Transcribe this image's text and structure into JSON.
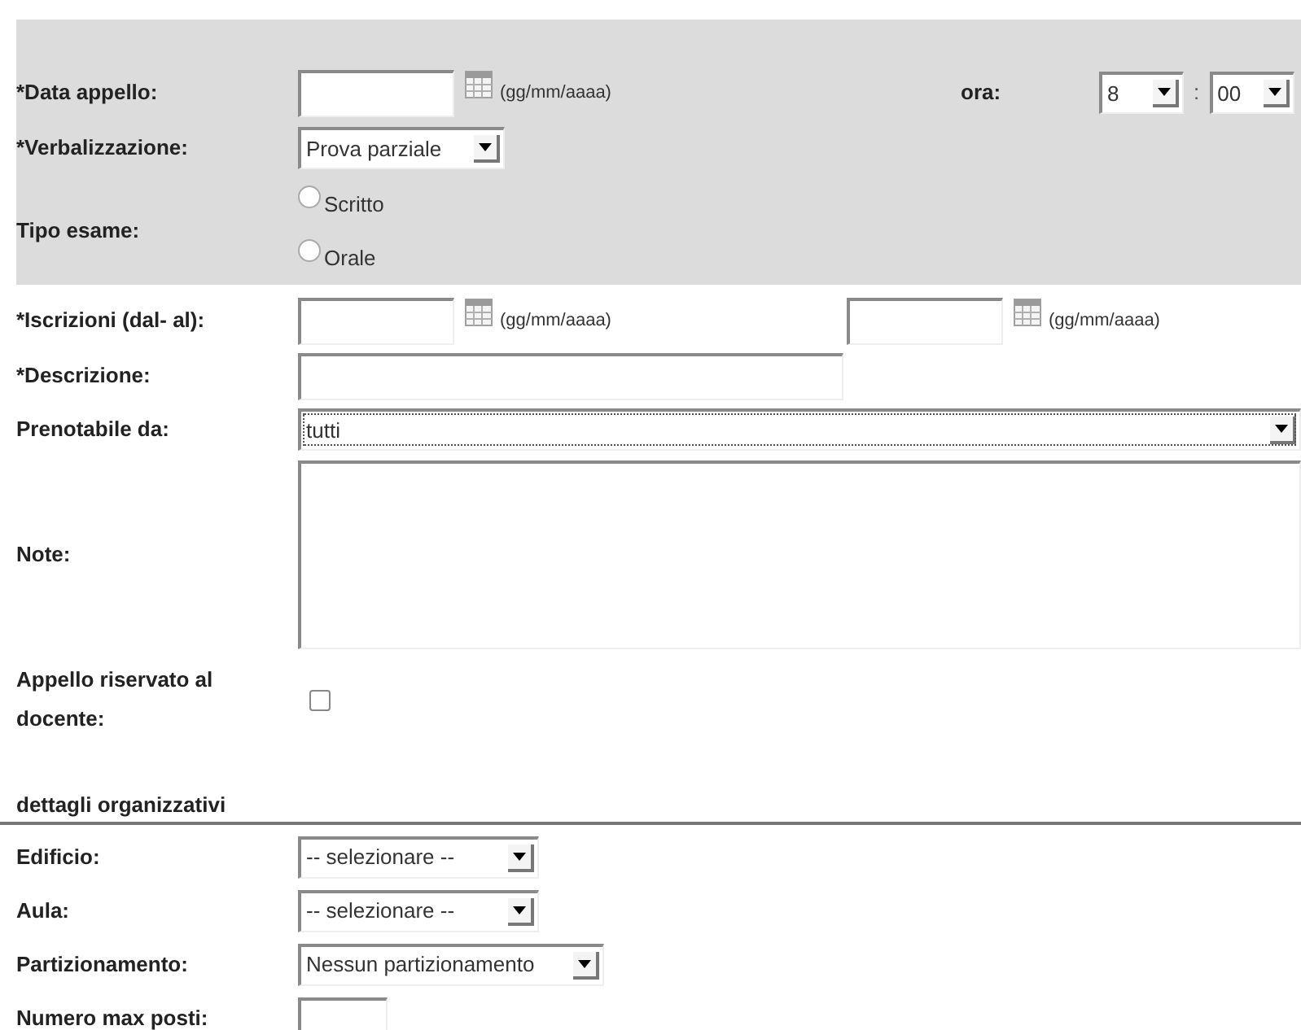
{
  "exam_section": {
    "date": {
      "label": "*Data appello:",
      "format_hint": "(gg/mm/aaaa)"
    },
    "time": {
      "label": "ora:",
      "hour": "8",
      "separator": ":",
      "minute": "00"
    },
    "verbalizzazione": {
      "label": "*Verbalizzazione:",
      "value": "Prova parziale"
    },
    "exam_type": {
      "label": "Tipo esame:",
      "options": [
        {
          "label": "Scritto",
          "selected": false
        },
        {
          "label": "Orale",
          "selected": false
        }
      ]
    }
  },
  "iscrizioni": {
    "label": "*Iscrizioni (dal- al):",
    "from_hint": "(gg/mm/aaaa)",
    "to_hint": "(gg/mm/aaaa)"
  },
  "descrizione": {
    "label": "*Descrizione:"
  },
  "prenotabile": {
    "label": "Prenotabile da:",
    "value": "tutti",
    "focused": true
  },
  "note": {
    "label": "Note:"
  },
  "riservato": {
    "label": "Appello riservato al docente:",
    "checked": false
  },
  "details": {
    "title": "dettagli organizzativi",
    "fields": [
      {
        "kind": "select",
        "label": "Edificio:",
        "value": "-- selezionare --"
      },
      {
        "kind": "select",
        "label": "Aula:",
        "value": "-- selezionare --"
      },
      {
        "kind": "select",
        "label": "Partizionamento:",
        "value": "Nessun partizionamento"
      },
      {
        "kind": "input",
        "label": "Numero max posti:"
      }
    ]
  }
}
